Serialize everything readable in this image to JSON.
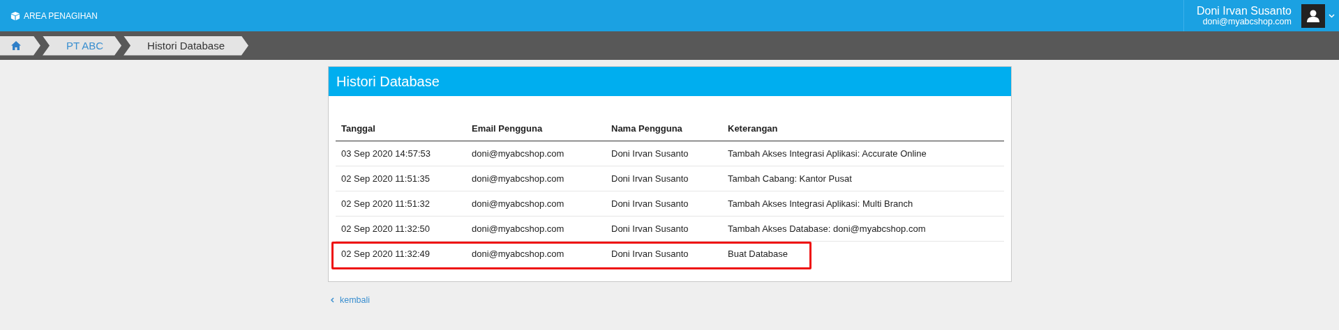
{
  "topbar": {
    "title": "AREA PENAGIHAN",
    "user_name": "Doni Irvan Susanto",
    "user_email": "doni@myabcshop.com"
  },
  "breadcrumb": [
    {
      "kind": "home",
      "selected": false
    },
    {
      "kind": "text",
      "label": "PT ABC",
      "selected": false
    },
    {
      "kind": "text",
      "label": "Histori Database",
      "selected": true
    }
  ],
  "panel": {
    "title": "Histori Database"
  },
  "table": {
    "columns": [
      "Tanggal",
      "Email Pengguna",
      "Nama Pengguna",
      "Keterangan"
    ],
    "rows": [
      {
        "cells": [
          "03 Sep 2020 14:57:53",
          "doni@myabcshop.com",
          "Doni Irvan Susanto",
          "Tambah Akses Integrasi Aplikasi: Accurate Online"
        ],
        "highlighted": false
      },
      {
        "cells": [
          "02 Sep 2020 11:51:35",
          "doni@myabcshop.com",
          "Doni Irvan Susanto",
          "Tambah Cabang: Kantor Pusat"
        ],
        "highlighted": false
      },
      {
        "cells": [
          "02 Sep 2020 11:51:32",
          "doni@myabcshop.com",
          "Doni Irvan Susanto",
          "Tambah Akses Integrasi Aplikasi: Multi Branch"
        ],
        "highlighted": false
      },
      {
        "cells": [
          "02 Sep 2020 11:32:50",
          "doni@myabcshop.com",
          "Doni Irvan Susanto",
          "Tambah Akses Database: doni@myabcshop.com"
        ],
        "highlighted": false
      },
      {
        "cells": [
          "02 Sep 2020 11:32:49",
          "doni@myabcshop.com",
          "Doni Irvan Susanto",
          "Buat Database"
        ],
        "highlighted": true
      }
    ]
  },
  "back_link": "kembali"
}
